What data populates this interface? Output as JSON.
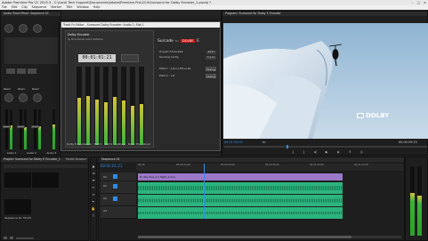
{
  "app": {
    "title": "Adobe Premiere Pro CC 2015.3 - C:\\Local Tech Support\\Documents\\Adobe\\Premiere Pro\\10.0\\Surround for Dolby Encoder_1.prproj *",
    "window_buttons": [
      "–",
      "□",
      "×"
    ]
  },
  "menu": [
    "File",
    "Edit",
    "Clip",
    "Sequence",
    "Marker",
    "Title",
    "Window",
    "Help"
  ],
  "mixer": {
    "tabs": [
      "Audio Track Mixer: Sequence 01",
      "Effect Controls",
      "Metadata"
    ],
    "channels": [
      "Audio 1",
      "Audio 2",
      "Audio 3",
      "Master"
    ],
    "read_labels": [
      "Read",
      "Read",
      "Read",
      "Read"
    ]
  },
  "plugin": {
    "window_title": "Track Fx Editor - Surround Dolby Encoder: Audio 2, Slot 1",
    "brand_left": "Dolby Encoder",
    "brand_sub": "by Minnetonka Audio Software",
    "counter": "00:01:01:21",
    "logo_prefix": "Surcode",
    "logo_for": "for",
    "logo_dolby": "DOLBY",
    "logo_suffix": "E",
    "fields": [
      {
        "label": "Program Frame Rate",
        "value": "29.97"
      },
      {
        "label": "Decoding Config",
        "value": "5.1+2"
      }
    ],
    "programs": [
      {
        "label": "PGM 1 - L,R,C,LFE,Ls,Rs",
        "button": "Dialog"
      },
      {
        "label": "PGM 2 - L,R",
        "button": "Dialog"
      }
    ],
    "footer_tabs": [
      "Dolby E Parameters",
      "PGM 1",
      "PGM 2",
      "Settings",
      "Meter Fils",
      "About"
    ]
  },
  "program_monitor": {
    "tabs": [
      "Source: (no clips)",
      "Audio Track Mixer: Sequence 01",
      "Program: Surround for Dolby E Encoder"
    ],
    "timecode_left": "00:01:04:05",
    "timecode_right": "00:00:59:23",
    "fit_label": "Fit",
    "watermark": "DOLBY"
  },
  "project": {
    "tabs": [
      "Project: Surround for Dolby E Encoder_1",
      "Media Browser",
      "Info",
      "Effects"
    ],
    "item_label": "Sequence 01",
    "duration": "59:23"
  },
  "timeline": {
    "tab": "Sequence 01",
    "timecode": "00:01:01:21",
    "clip_label": "fx: Sky dive_b 2 flight_1.mov",
    "ruler_ticks": [
      "00:00",
      "00:00:15:00",
      "00:00:30:00",
      "00:00:45:00",
      "00:01:00:00",
      "00:01:15:00",
      "00:01:30:00"
    ],
    "tracks": [
      "V1",
      "A1",
      "A2",
      "A3"
    ]
  },
  "colors": {
    "accent_blue": "#2d8ceb",
    "clip_green": "#2db47e",
    "clip_purple": "#9a79c8",
    "dolby_red": "#cc1b1b"
  }
}
